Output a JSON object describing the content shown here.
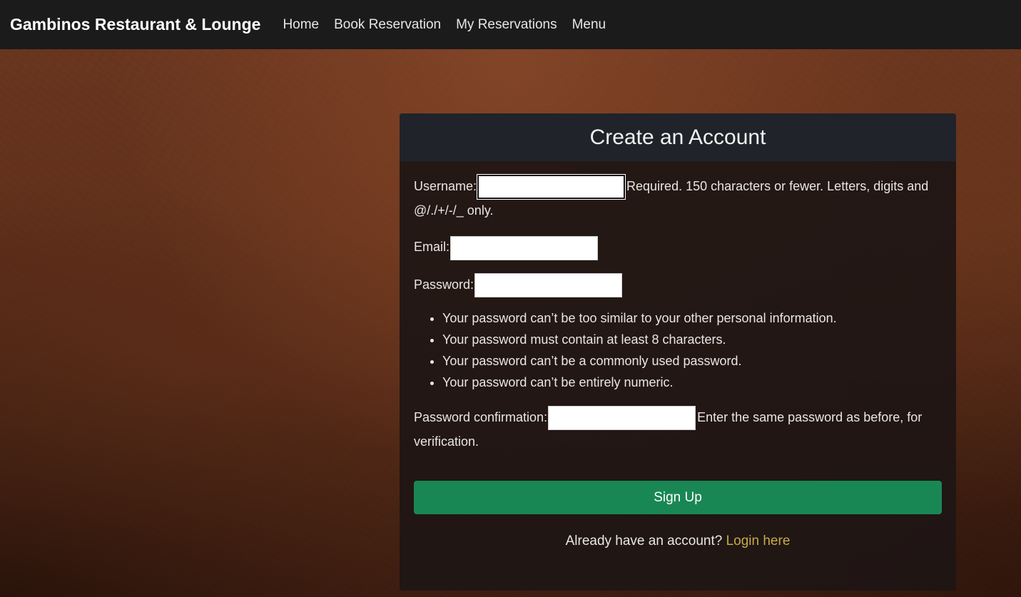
{
  "nav": {
    "brand": "Gambinos Restaurant & Lounge",
    "links": [
      "Home",
      "Book Reservation",
      "My Reservations",
      "Menu"
    ]
  },
  "form": {
    "title": "Create an Account",
    "username": {
      "label": "Username:",
      "value": "",
      "help": "Required. 150 characters or fewer. Letters, digits and @/./+/-/_ only."
    },
    "email": {
      "label": "Email:",
      "value": ""
    },
    "password": {
      "label": "Password:",
      "value": ""
    },
    "password_rules": [
      "Your password can’t be too similar to your other personal information.",
      "Your password must contain at least 8 characters.",
      "Your password can’t be a commonly used password.",
      "Your password can’t be entirely numeric."
    ],
    "password_confirmation": {
      "label": "Password confirmation:",
      "value": "",
      "help": "Enter the same password as before, for verification."
    },
    "submit_label": "Sign Up",
    "login_prompt": "Already have an account?",
    "login_link": "Login here"
  },
  "colors": {
    "navbar": "#1b1b1b",
    "card_header": "#20232a",
    "button": "#198754",
    "link": "#c9a94a",
    "background": "#5a2e1a"
  }
}
